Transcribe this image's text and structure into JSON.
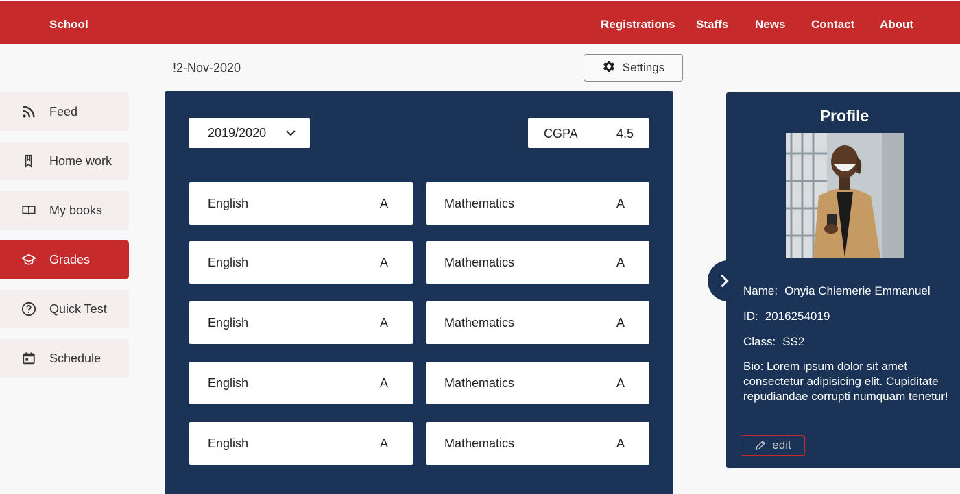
{
  "header": {
    "brand": "School",
    "nav": [
      "Registrations",
      "Staffs",
      "News",
      "Contact",
      "About"
    ]
  },
  "date": "!2-Nov-2020",
  "settings_label": "Settings",
  "sidebar": {
    "items": [
      {
        "label": "Feed",
        "icon": "rss-icon",
        "active": false
      },
      {
        "label": "Home work",
        "icon": "bookmark-icon",
        "active": false
      },
      {
        "label": "My books",
        "icon": "open-book-icon",
        "active": false
      },
      {
        "label": "Grades",
        "icon": "graduation-cap-icon",
        "active": true
      },
      {
        "label": "Quick Test",
        "icon": "question-circle-icon",
        "active": false
      },
      {
        "label": "Schedule",
        "icon": "calendar-icon",
        "active": false
      }
    ]
  },
  "grades_panel": {
    "session": "2019/2020",
    "cgpa_label": "CGPA",
    "cgpa_value": "4.5",
    "rows": [
      [
        {
          "subject": "English",
          "grade": "A"
        },
        {
          "subject": "Mathematics",
          "grade": "A"
        }
      ],
      [
        {
          "subject": "English",
          "grade": "A"
        },
        {
          "subject": "Mathematics",
          "grade": "A"
        }
      ],
      [
        {
          "subject": "English",
          "grade": "A"
        },
        {
          "subject": "Mathematics",
          "grade": "A"
        }
      ],
      [
        {
          "subject": "English",
          "grade": "A"
        },
        {
          "subject": "Mathematics",
          "grade": "A"
        }
      ],
      [
        {
          "subject": "English",
          "grade": "A"
        },
        {
          "subject": "Mathematics",
          "grade": "A"
        }
      ]
    ]
  },
  "profile": {
    "title": "Profile",
    "name_label": "Name:",
    "name": "Onyia Chiemerie Emmanuel",
    "id_label": "ID:",
    "id": "2016254019",
    "class_label": "Class:",
    "class": "SS2",
    "bio": "Bio: Lorem ipsum dolor sit amet consectetur adipisicing elit. Cupiditate repudiandae corrupti numquam tenetur!",
    "edit_label": "edit"
  },
  "colors": {
    "brand_red": "#c62a2a",
    "navy": "#1a3356",
    "sidebar_bg": "#f4eeee"
  }
}
